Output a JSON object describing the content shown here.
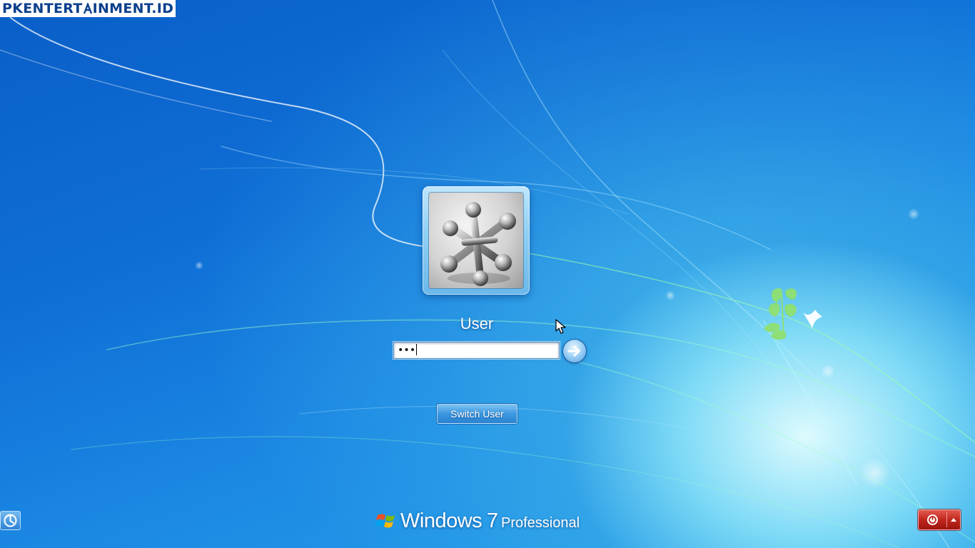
{
  "watermark": {
    "text": "PKENTERTAINMENT.ID",
    "part1": "PKENTERT",
    "part2": "INMENT.ID"
  },
  "login": {
    "username": "User",
    "password_mask": "•••",
    "avatar": "jacks-avatar-picture"
  },
  "buttons": {
    "submit_icon": "arrow-right-icon",
    "switch_user_label": "Switch User",
    "ease_of_access_icon": "ease-of-access-icon",
    "power_icon": "power-icon",
    "power_options_icon": "chevron-up-icon"
  },
  "branding": {
    "name": "Windows",
    "version": "7",
    "edition": "Professional"
  },
  "colors": {
    "background_dark": "#0a5ec8",
    "background_light": "#8fe2f8",
    "power_red": "#c0261c",
    "watermark_text": "#0b3f8c"
  }
}
